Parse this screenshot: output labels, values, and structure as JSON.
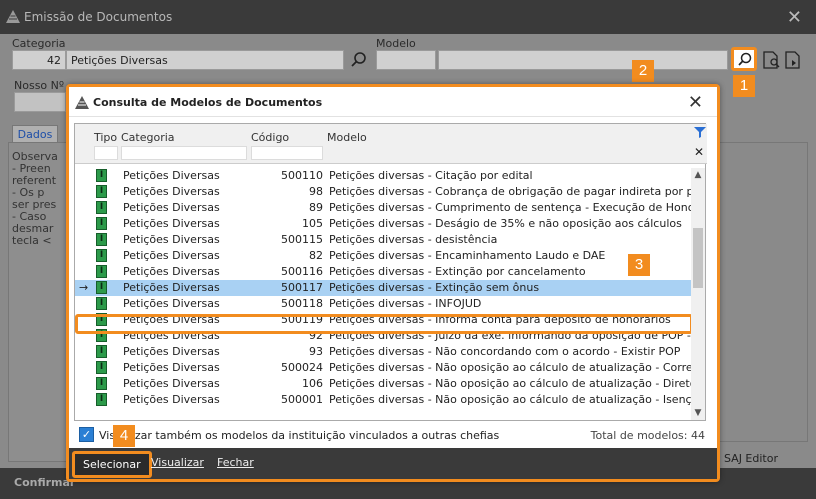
{
  "parent": {
    "title": "Emissão de Documentos",
    "categoria_label": "Categoria",
    "categoria_code": "42",
    "categoria_value": "Petições Diversas",
    "modelo_label": "Modelo",
    "nosso_label": "Nosso Nº",
    "tab_dados": "Dados",
    "obs_lines": [
      "Observa",
      "- Preen",
      "referent",
      "- Os p",
      "ser pres",
      "- Caso",
      "desmar",
      "tecla <"
    ],
    "saj_editor": "SAJ Editor",
    "confirm": "Confirmar"
  },
  "dialog": {
    "title": "Consulta de Modelos de Documentos",
    "columns": {
      "tipo": "Tipo",
      "categoria": "Categoria",
      "codigo": "Código",
      "modelo": "Modelo"
    },
    "rows": [
      {
        "cat": "Petições Diversas",
        "cod": "500110",
        "mod": "Petições diversas - Citação por edital"
      },
      {
        "cat": "Petições Diversas",
        "cod": "98",
        "mod": "Petições diversas - Cobrança de obrigação de pagar indireta por precat"
      },
      {
        "cat": "Petições Diversas",
        "cod": "89",
        "mod": "Petições diversas - Cumprimento de sentença - Execução de Honorários"
      },
      {
        "cat": "Petições Diversas",
        "cod": "105",
        "mod": "Petições diversas - Deságio de 35% e não oposição aos cálculos"
      },
      {
        "cat": "Petições Diversas",
        "cod": "500115",
        "mod": "Petições diversas - desistência"
      },
      {
        "cat": "Petições Diversas",
        "cod": "82",
        "mod": "Petições diversas - Encaminhamento Laudo e DAE"
      },
      {
        "cat": "Petições Diversas",
        "cod": "500116",
        "mod": "Petições diversas - Extinção por cancelamento"
      },
      {
        "cat": "Petições Diversas",
        "cod": "500117",
        "mod": "Petições diversas - Extinção sem ônus"
      },
      {
        "cat": "Petições Diversas",
        "cod": "500118",
        "mod": "Petições diversas - INFOJUD"
      },
      {
        "cat": "Petições Diversas",
        "cod": "500119",
        "mod": "Petições diversas - Informa conta para deposito de honorários"
      },
      {
        "cat": "Petições Diversas",
        "cod": "92",
        "mod": "Petições diversas - Juizo da exe. informando da oposição de POP - SISPE"
      },
      {
        "cat": "Petições Diversas",
        "cod": "93",
        "mod": "Petições diversas - Não concordando com o acordo - Existir POP"
      },
      {
        "cat": "Petições Diversas",
        "cod": "500024",
        "mod": "Petições diversas - Não oposição ao cálculo de atualização - Correção m"
      },
      {
        "cat": "Petições Diversas",
        "cod": "106",
        "mod": "Petições diversas - Não oposição ao cálculo de atualização - Direto a pr"
      },
      {
        "cat": "Petições Diversas",
        "cod": "500001",
        "mod": "Petições diversas - Não oposição ao cálculo de atualização - Isenção de"
      }
    ],
    "selected_index": 7,
    "checkbox_label": "Visualizar também os modelos da instituição vinculados a outras chefias",
    "total": "Total de modelos: 44",
    "buttons": {
      "select": "Selecionar",
      "view": "Visualizar",
      "close": "Fechar"
    }
  },
  "badges": [
    "1",
    "2",
    "3",
    "4"
  ]
}
